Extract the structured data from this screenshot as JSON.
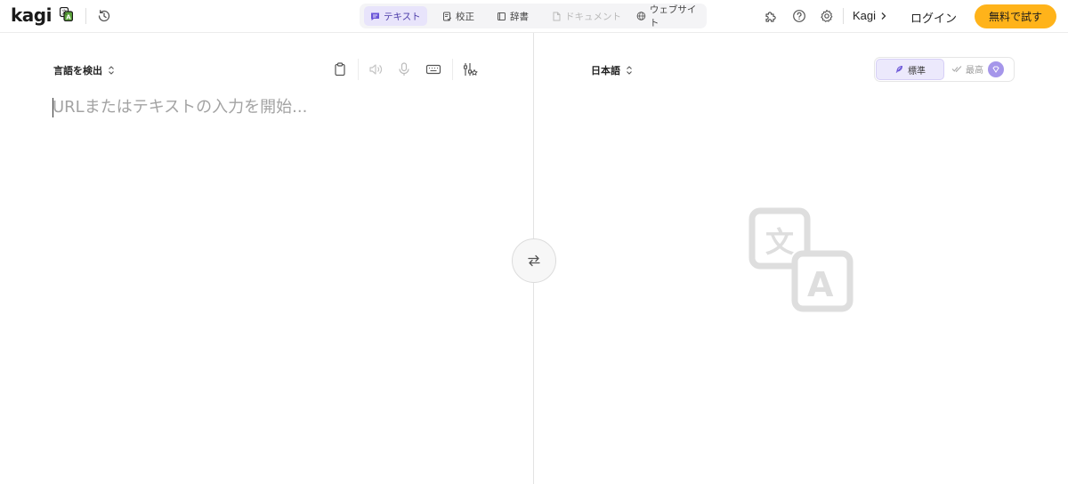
{
  "brand": {
    "logo_text": "kagi"
  },
  "mode_tabs": [
    {
      "label": "テキスト",
      "icon": "chat-bubble-icon",
      "active": true
    },
    {
      "label": "校正",
      "icon": "proofread-icon"
    },
    {
      "label": "辞書",
      "icon": "book-icon"
    },
    {
      "label": "ドキュメント",
      "icon": "document-icon",
      "disabled": true
    },
    {
      "label": "ウェブサイト",
      "icon": "globe-icon"
    }
  ],
  "header": {
    "kagi_link": "Kagi",
    "login": "ログイン",
    "trial_button": "無料で試す"
  },
  "source": {
    "language": "言語を検出",
    "placeholder": "URLまたはテキストの入力を開始..."
  },
  "target": {
    "language": "日本語",
    "quality_standard": "標準",
    "quality_best": "最高"
  },
  "colors": {
    "accent_purple": "#ece9fc",
    "trial_orange": "#ffb31a",
    "gem_purple": "#a596ea"
  }
}
